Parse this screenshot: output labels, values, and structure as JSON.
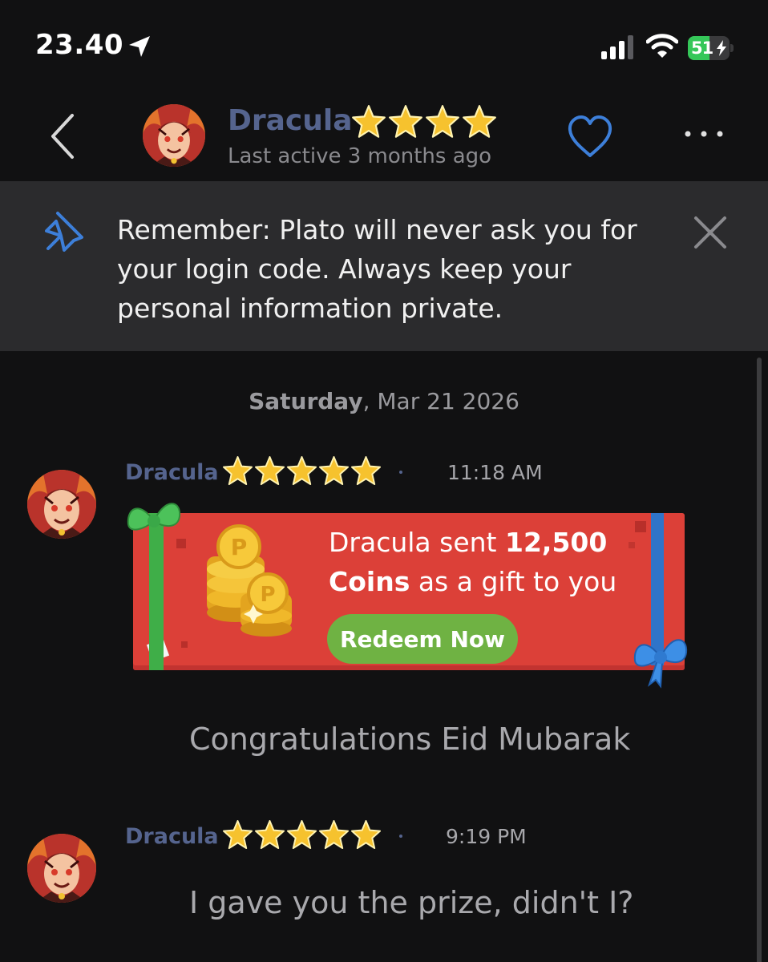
{
  "status_bar": {
    "time": "23.40",
    "battery_level": "51",
    "battery_fraction": 0.51,
    "icons": [
      "location-arrow-icon",
      "cellular-signal-icon",
      "wifi-icon",
      "battery-charging-icon"
    ]
  },
  "header": {
    "name": "Dracula",
    "stars": 4,
    "last_active": "Last active 3 months ago",
    "icons": [
      "back-chevron-icon",
      "heart-icon",
      "more-dots-icon"
    ]
  },
  "banner": {
    "text": "Remember: Plato will never ask you for your login code. Always keep your personal information private.",
    "icons": [
      "pin-icon",
      "close-icon"
    ]
  },
  "chat": {
    "date_day": "Saturday",
    "date_rest": ", Mar 21 2026",
    "messages": [
      {
        "sender": "Dracula",
        "stars": 5,
        "time": "11:18 AM",
        "gift": {
          "line_prefix": "Dracula sent ",
          "amount": "12,500",
          "unit": "Coins",
          "line_suffix": " as a gift to you",
          "button": "Redeem Now"
        },
        "text": "Congratulations Eid Mubarak"
      },
      {
        "sender": "Dracula",
        "stars": 5,
        "time": "9:19 PM",
        "text": "I gave you the prize, didn't I?"
      }
    ]
  },
  "colors": {
    "background": "#111112",
    "accent_blue": "#3d7fd9",
    "name_color": "#55648e",
    "gift_red": "#dc4038",
    "redeem_green": "#6fb243",
    "star_gold": "#f6c22e"
  }
}
